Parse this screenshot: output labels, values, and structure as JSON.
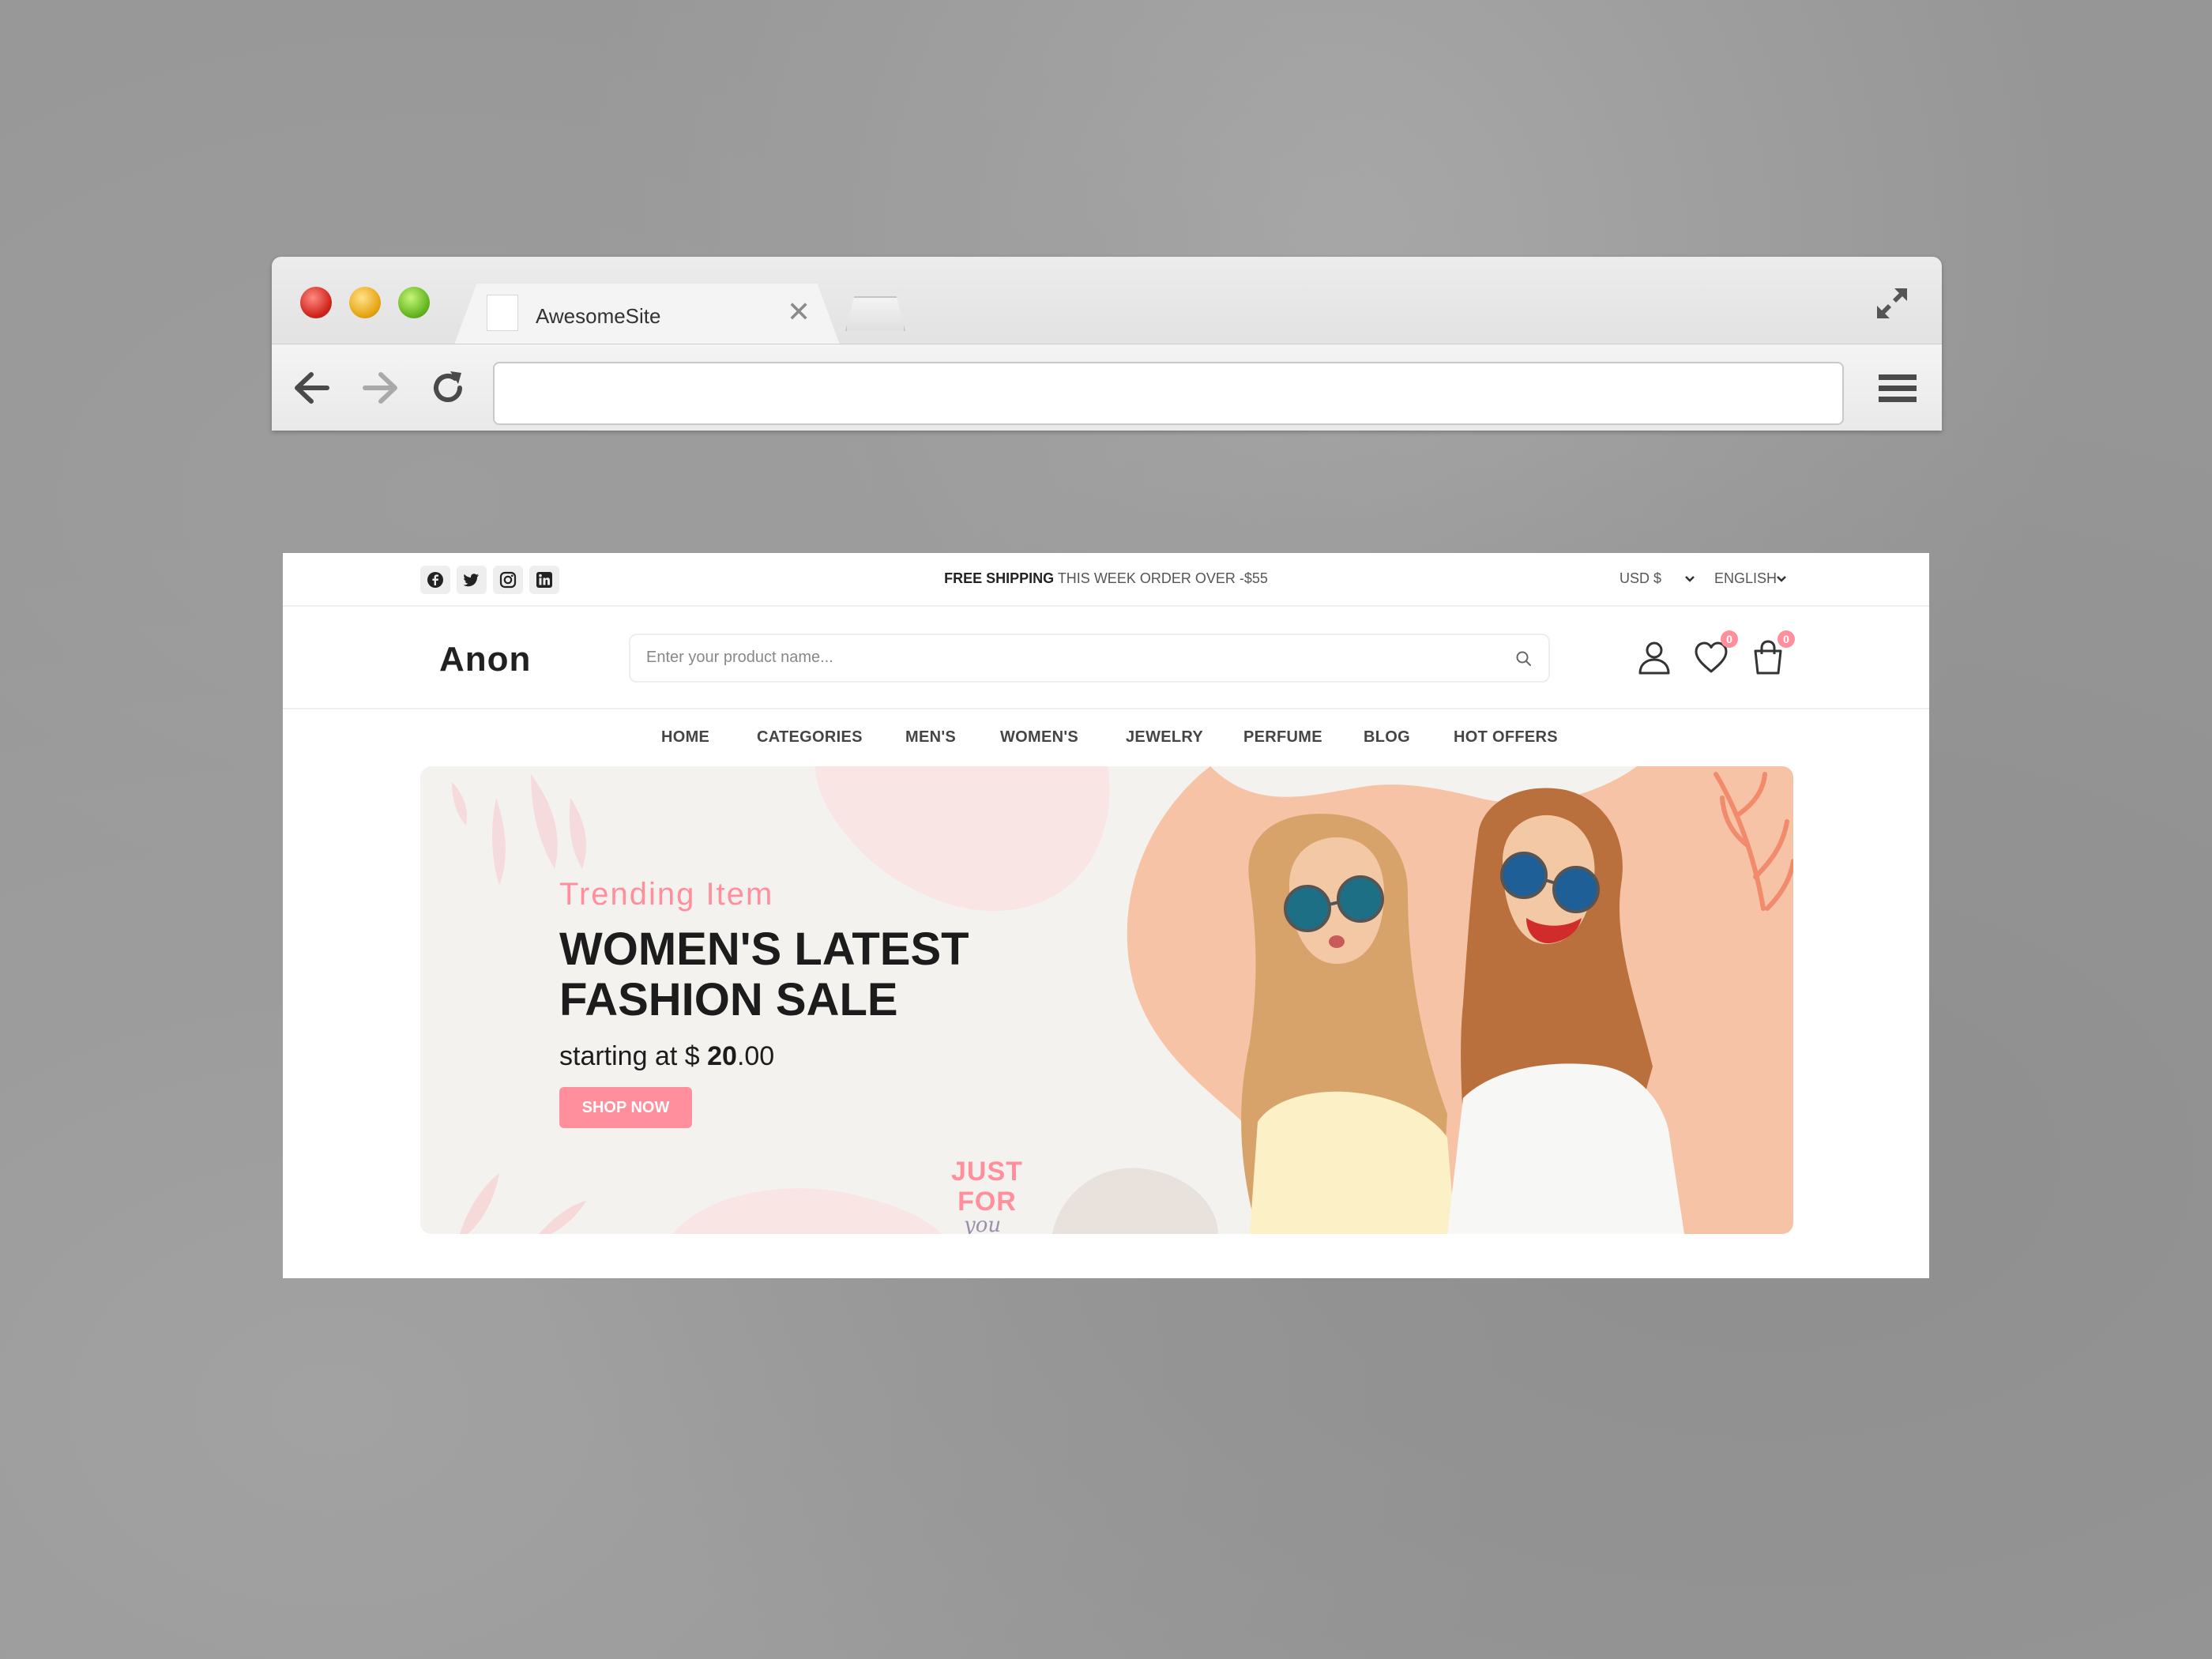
{
  "browser": {
    "tab_title": "AwesomeSite",
    "url": "",
    "icons": [
      "close-icon",
      "back-arrow-icon",
      "forward-arrow-icon",
      "reload-icon",
      "fullscreen-icon",
      "hamburger-menu-icon"
    ]
  },
  "topbar": {
    "social": [
      "facebook-icon",
      "twitter-icon",
      "instagram-icon",
      "linkedin-icon"
    ],
    "shipping_bold": "FREE SHIPPING",
    "shipping_text": " THIS WEEK ORDER OVER -$55",
    "currency": "USD $",
    "language": "ENGLISH"
  },
  "header": {
    "logo": "Anon",
    "search_placeholder": "Enter your product name...",
    "wishlist_count": "0",
    "cart_count": "0"
  },
  "nav": {
    "items": [
      "HOME",
      "CATEGORIES",
      "MEN'S",
      "WOMEN'S",
      "JEWELRY",
      "PERFUME",
      "BLOG",
      "HOT OFFERS"
    ]
  },
  "hero": {
    "subtitle": "Trending Item",
    "title_line1": "WOMEN'S LATEST",
    "title_line2": "FASHION SALE",
    "price_prefix": "starting at $ ",
    "price_value": "20",
    "price_cents": ".00",
    "button": "SHOP NOW",
    "badge_line1": "JUST",
    "badge_line2": "FOR",
    "badge_line3": "you"
  },
  "colors": {
    "accent": "#ff8f9c",
    "hero_bg": "#f4f2ee",
    "peach": "#f6c3a6"
  }
}
